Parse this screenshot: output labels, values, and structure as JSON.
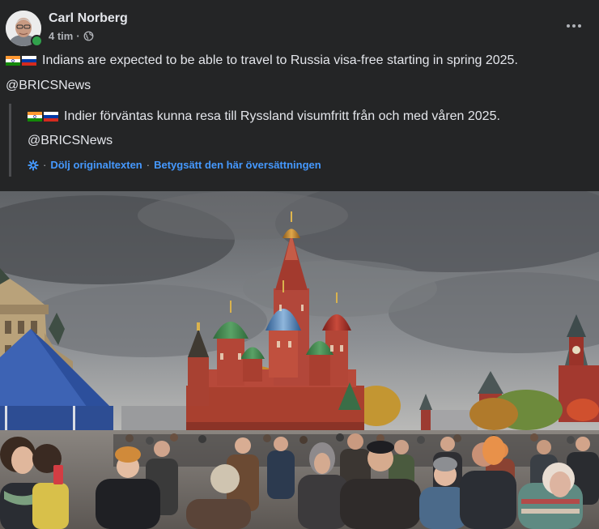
{
  "post": {
    "author": "Carl Norberg",
    "time": "4 tim",
    "dot": "·",
    "line1": "Indians are expected to be able to travel to Russia visa-free starting in spring 2025.",
    "line2": "@BRICSNews"
  },
  "translation": {
    "line1": "Indier förväntas kunna resa till Ryssland visumfritt från och med våren 2025.",
    "line2": "@BRICSNews",
    "sep": "·",
    "hide_original": "Dölj originaltexten",
    "rate_translation": "Betygsätt den här översättningen"
  },
  "icons": {
    "globe": "globe-icon",
    "more": "more-icon",
    "settings": "gear-icon",
    "flag_india": "india-flag-icon",
    "flag_russia": "russia-flag-icon"
  },
  "colors": {
    "background": "#242526",
    "text": "#e4e6eb",
    "secondary": "#b0b3b8",
    "link": "#4599ff",
    "online": "#31a24c"
  }
}
